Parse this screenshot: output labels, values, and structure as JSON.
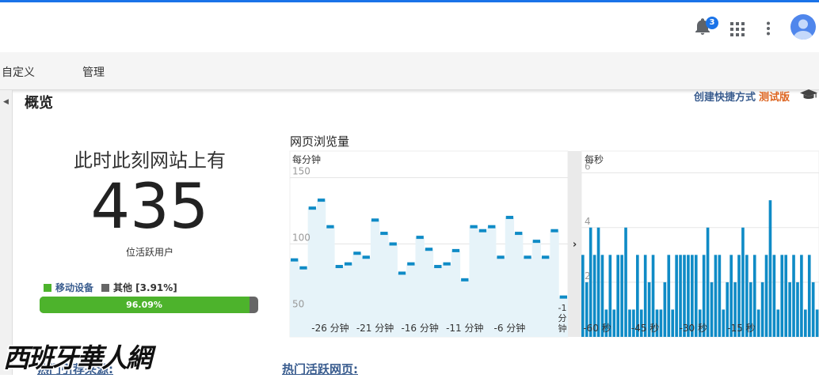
{
  "header": {
    "notification_count": "3",
    "icons": [
      "bell-icon",
      "apps-grid-icon",
      "more-vert-icon",
      "avatar"
    ]
  },
  "nav": {
    "items": [
      "自定义",
      "管理"
    ]
  },
  "page": {
    "title": "概览",
    "create_shortcut": "创建快捷方式",
    "beta": "测试版"
  },
  "realtime": {
    "headline": "此时此刻网站上有",
    "active_users": "435",
    "active_label": "位活跃用户",
    "legend": [
      {
        "label": "移动设备",
        "color": "#4db32c"
      },
      {
        "label": "其他 [3.91%]",
        "color": "#666666"
      }
    ],
    "mobile_percent": 96.09,
    "mobile_percent_label": "96.09%"
  },
  "sections": {
    "referrals": "热门引荐来源:",
    "active_pages": "热门活跃网页:"
  },
  "watermark": "西班牙華人網",
  "colors": {
    "accent": "#1a73e8",
    "bar": "#0f8bc6",
    "area": "#e6f3f9",
    "green": "#4db32c"
  },
  "chart_data": [
    {
      "type": "area",
      "title": "网页浏览量",
      "subtitle": "每分钟",
      "ylim": [
        30,
        170
      ],
      "yticks": [
        50,
        100,
        150
      ],
      "x": [
        -30,
        -29,
        -28,
        -27,
        -26,
        -25,
        -24,
        -23,
        -22,
        -21,
        -20,
        -19,
        -18,
        -17,
        -16,
        -15,
        -14,
        -13,
        -12,
        -11,
        -10,
        -9,
        -8,
        -7,
        -6,
        -5,
        -4,
        -3,
        -2,
        -1,
        0
      ],
      "values": [
        88,
        82,
        127,
        133,
        113,
        83,
        85,
        93,
        90,
        118,
        108,
        100,
        78,
        85,
        105,
        96,
        83,
        85,
        95,
        73,
        113,
        110,
        113,
        90,
        120,
        108,
        90,
        102,
        90,
        110,
        60
      ],
      "x_tick_labels": [
        "-26 分钟",
        "-21 分钟",
        "-16 分钟",
        "-11 分钟",
        "-6 分钟",
        "-1 分钟"
      ]
    },
    {
      "type": "bar",
      "title": "",
      "subtitle": "每秒",
      "ylim": [
        0,
        6.8
      ],
      "yticks": [
        2,
        4,
        6
      ],
      "x": [
        -60,
        -59,
        -58,
        -57,
        -56,
        -55,
        -54,
        -53,
        -52,
        -51,
        -50,
        -49,
        -48,
        -47,
        -46,
        -45,
        -44,
        -43,
        -42,
        -41,
        -40,
        -39,
        -38,
        -37,
        -36,
        -35,
        -34,
        -33,
        -32,
        -31,
        -30,
        -29,
        -28,
        -27,
        -26,
        -25,
        -24,
        -23,
        -22,
        -21,
        -20,
        -19,
        -18,
        -17,
        -16,
        -15,
        -14,
        -13,
        -12,
        -11,
        -10,
        -9,
        -8,
        -7,
        -6,
        -5,
        -4,
        -3,
        -2,
        -1,
        0
      ],
      "values": [
        3,
        2,
        4,
        3,
        4,
        3,
        1,
        3,
        1,
        3,
        3,
        4,
        1,
        1,
        3,
        1,
        3,
        2,
        3,
        1,
        1,
        2,
        3,
        1,
        3,
        3,
        3,
        3,
        3,
        3,
        1,
        3,
        4,
        2,
        3,
        3,
        1,
        2,
        3,
        2,
        3,
        4,
        3,
        2,
        3,
        1,
        2,
        3,
        5,
        3,
        1,
        3,
        3,
        2,
        3,
        2,
        3,
        1,
        3,
        2,
        1
      ],
      "x_tick_labels": [
        "-60 秒",
        "-45 秒",
        "-30 秒",
        "-15 秒"
      ]
    }
  ]
}
